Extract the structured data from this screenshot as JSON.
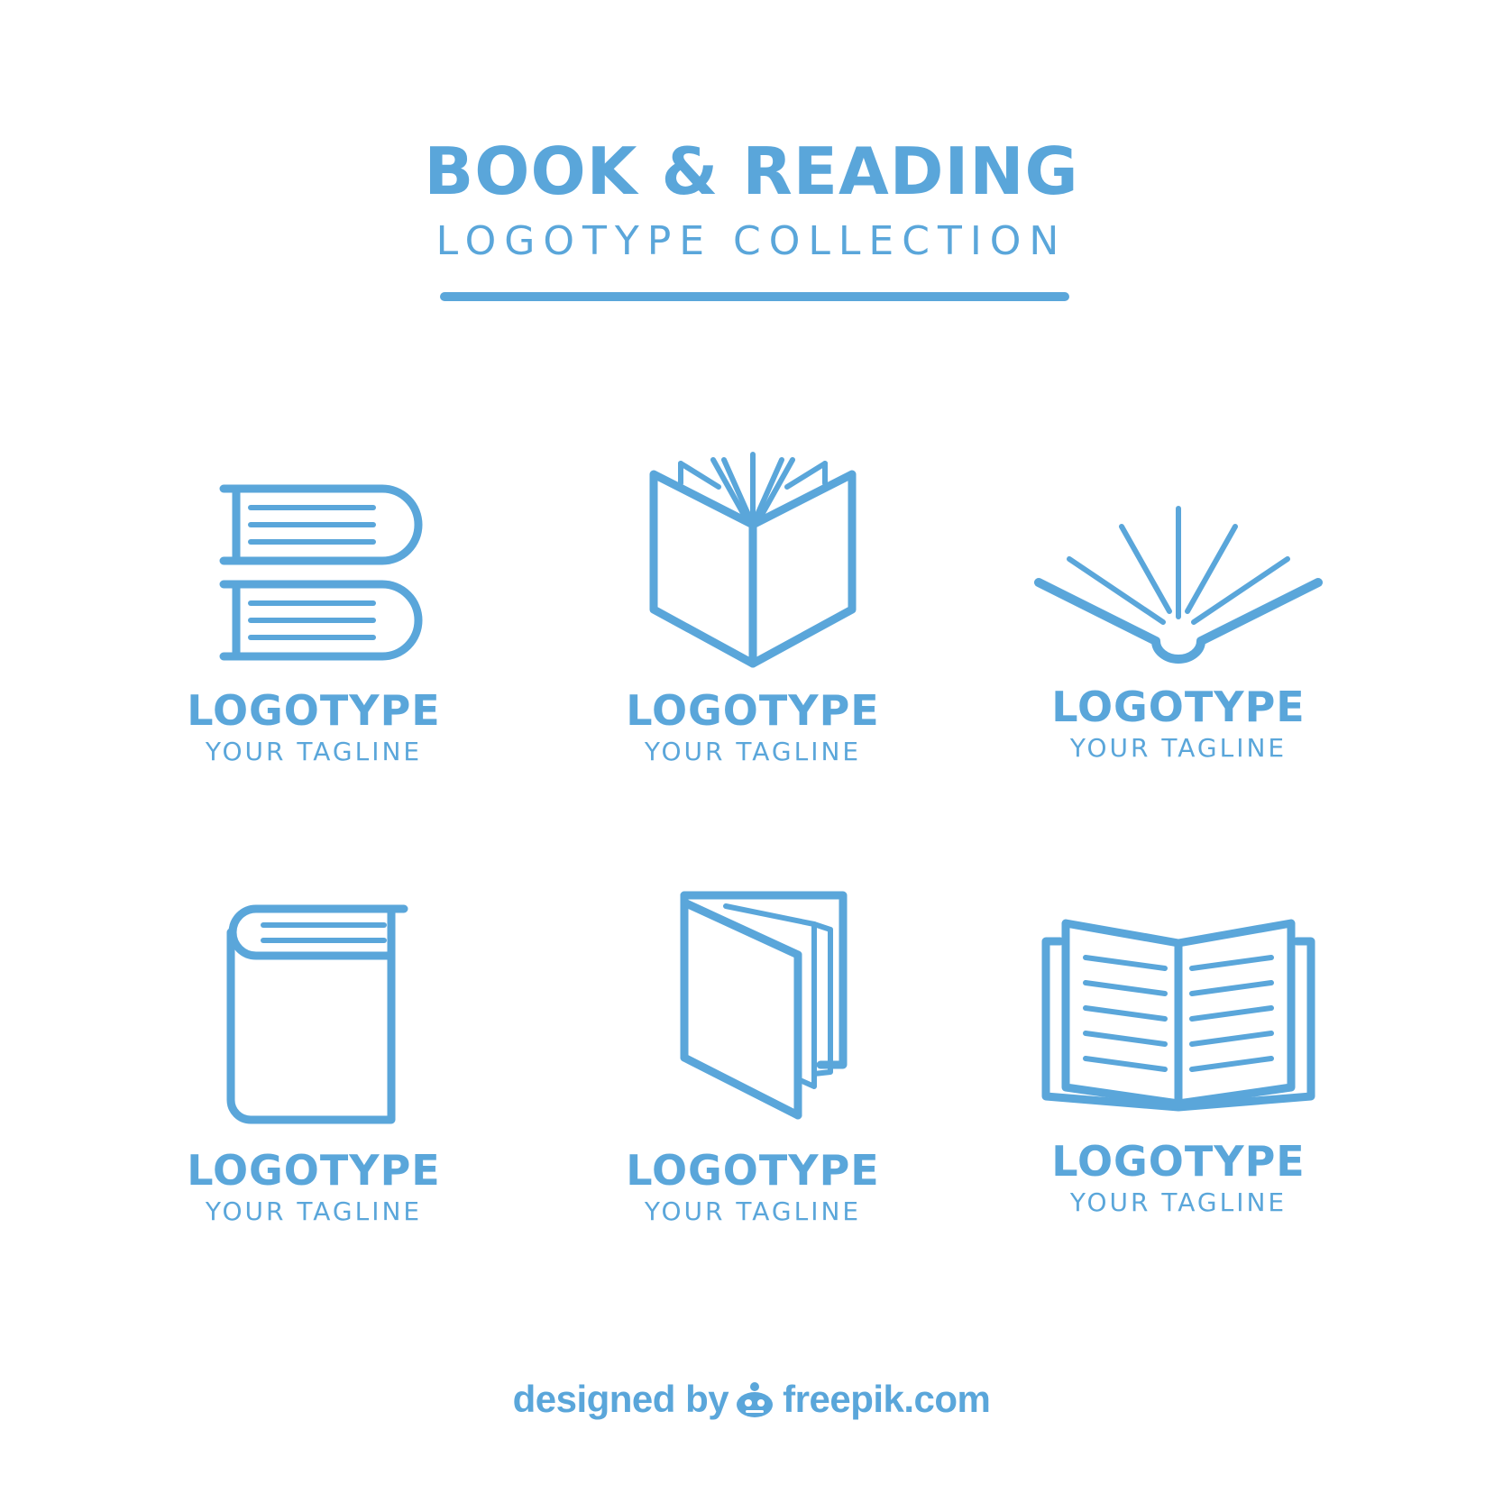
{
  "header": {
    "title": "BOOK & READING",
    "subtitle": "LOGOTYPE COLLECTION"
  },
  "logos": [
    {
      "icon": "stacked-books-icon",
      "name": "LOGOTYPE",
      "tagline": "YOUR TAGLINE"
    },
    {
      "icon": "open-book-pages-icon",
      "name": "LOGOTYPE",
      "tagline": "YOUR TAGLINE"
    },
    {
      "icon": "radiant-book-icon",
      "name": "LOGOTYPE",
      "tagline": "YOUR TAGLINE"
    },
    {
      "icon": "closed-book-icon",
      "name": "LOGOTYPE",
      "tagline": "YOUR TAGLINE"
    },
    {
      "icon": "standing-book-icon",
      "name": "LOGOTYPE",
      "tagline": "YOUR TAGLINE"
    },
    {
      "icon": "open-book-lines-icon",
      "name": "LOGOTYPE",
      "tagline": "YOUR TAGLINE"
    }
  ],
  "footer": {
    "designed_by": "designed by",
    "brand": "freepik.com"
  },
  "colors": {
    "accent": "#5aa6da",
    "background": "#ffffff"
  }
}
